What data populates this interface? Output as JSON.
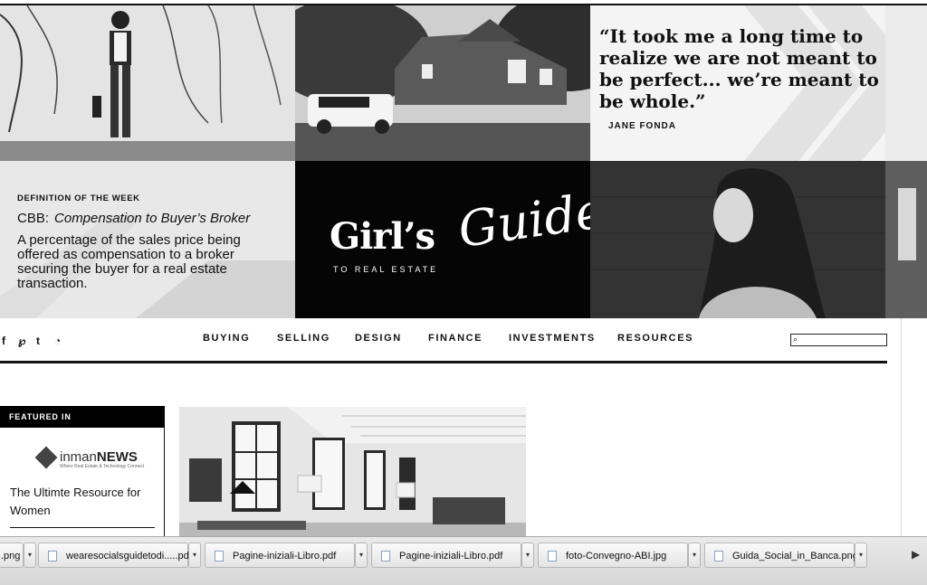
{
  "hero": {
    "quote": {
      "text": "“It took me a long time to realize we are not meant to be perfect... we’re meant to be whole.”",
      "author": "JANE FONDA"
    },
    "definition": {
      "kicker": "DEFINITION OF THE WEEK",
      "abbr": "CBB:",
      "term": "Compensation to Buyer’s Broker",
      "body": "A percentage of the sales price being offered as compensation to a broker securing the buyer for a real estate transaction."
    },
    "logo": {
      "main": "Girl’s",
      "script": "Guide",
      "sub": "TO REAL ESTATE"
    }
  },
  "social": [
    "f",
    "p",
    "t",
    "rss"
  ],
  "nav": {
    "items": [
      "BUYING",
      "SELLING",
      "DESIGN",
      "FINANCE",
      "INVESTMENTS",
      "RESOURCES"
    ]
  },
  "featured": {
    "heading": "FEATURED IN",
    "brand_light": "inman",
    "brand_bold": "NEWS",
    "brand_tagline": "Where Real Estate & Technology Connect",
    "title": "The Ultimte Resource for Women"
  },
  "downloads": {
    "items": [
      ".png",
      "wearesocialsguidetodi.....pdf",
      "Pagine-iniziali-Libro.pdf",
      "Pagine-iniziali-Libro.pdf",
      "foto-Convegno-ABI.jpg",
      "Guida_Social_in_Banca.png"
    ]
  },
  "icons": {
    "facebook": "facebook-icon",
    "pinterest": "pinterest-icon",
    "twitter": "twitter-icon",
    "rss": "rss-icon",
    "search": "search-icon",
    "download_menu": "chevron-down-icon",
    "file": "file-icon"
  }
}
